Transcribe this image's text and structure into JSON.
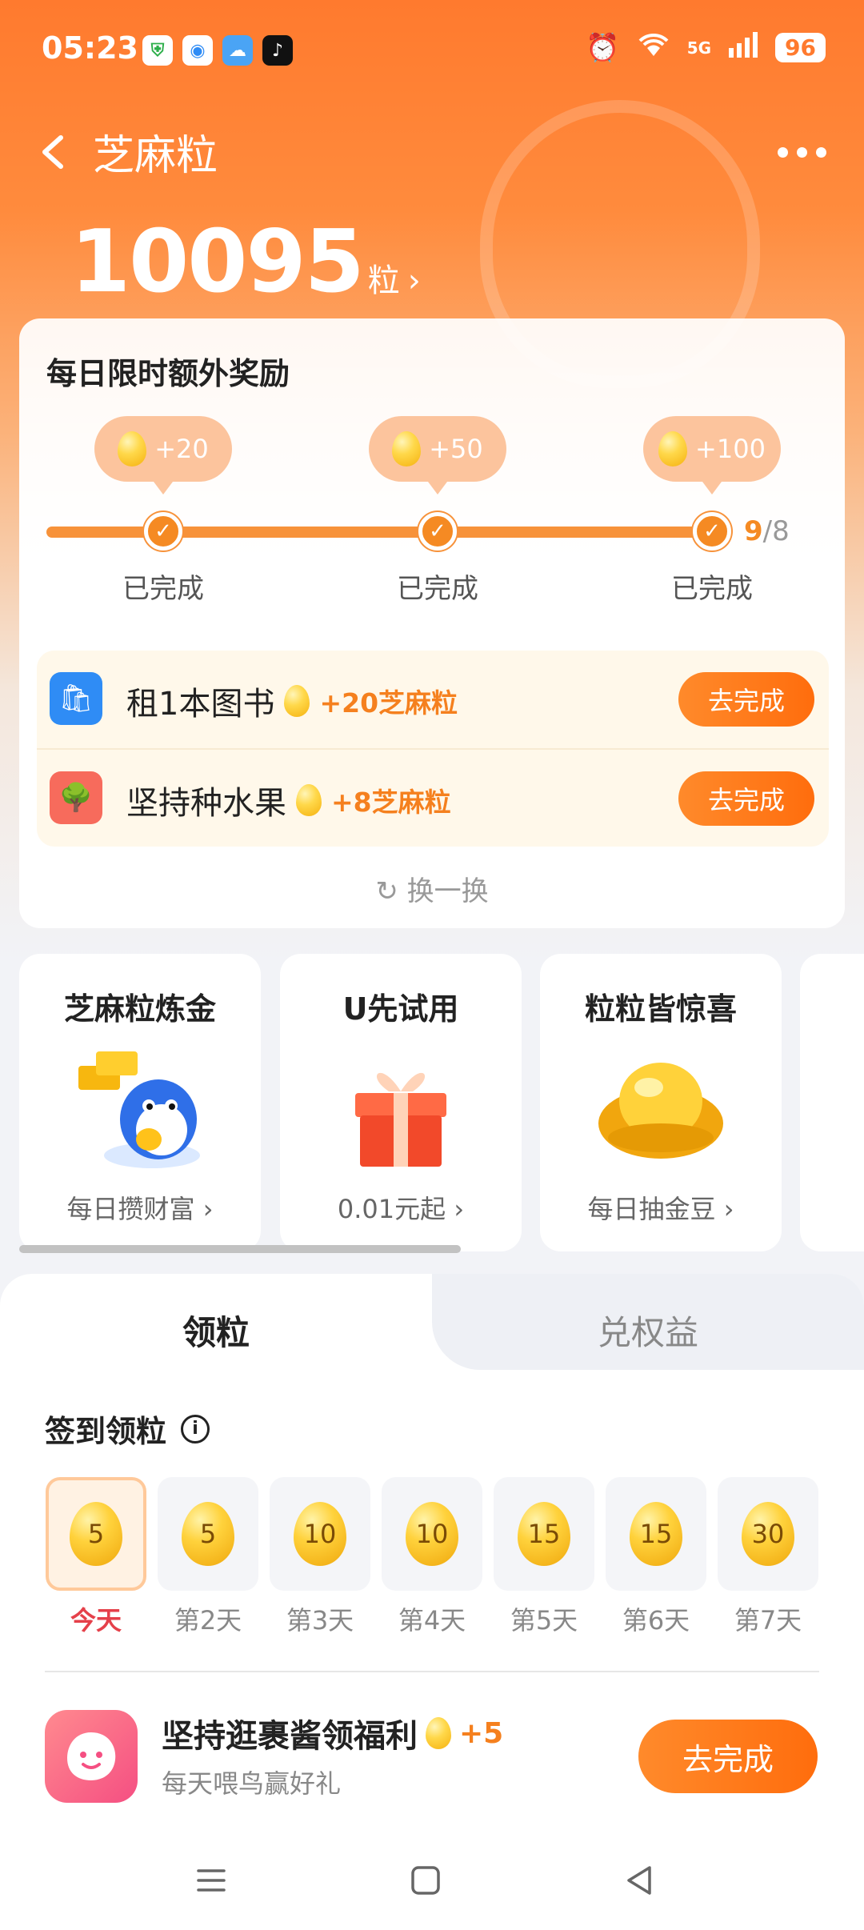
{
  "status_bar": {
    "time": "05:23",
    "network": "5G",
    "battery": "96"
  },
  "header": {
    "title": "芝麻粒"
  },
  "points": {
    "value": "10095",
    "unit": "粒"
  },
  "daily_bonus": {
    "title": "每日限时额外奖励",
    "milestones": [
      {
        "reward": "+20",
        "status": "已完成"
      },
      {
        "reward": "+50",
        "status": "已完成"
      },
      {
        "reward": "+100",
        "status": "已完成"
      }
    ],
    "progress_done": "9",
    "progress_total": "/8",
    "tasks": [
      {
        "title": "租1本图书",
        "reward": "+20芝麻粒",
        "button": "去完成",
        "icon_color": "#2f8cf5"
      },
      {
        "title": "坚持种水果",
        "reward": "+8芝麻粒",
        "button": "去完成",
        "icon_color": "#f76b5c"
      }
    ],
    "refresh": "换一换"
  },
  "promos": [
    {
      "title": "芝麻粒炼金",
      "subtitle": "每日攒财富"
    },
    {
      "title": "U先试用",
      "subtitle": "0.01元起"
    },
    {
      "title": "粒粒皆惊喜",
      "subtitle": "每日抽金豆"
    }
  ],
  "tabs": [
    {
      "label": "领粒"
    },
    {
      "label": "兑权益"
    }
  ],
  "signin": {
    "title": "签到领粒",
    "days": [
      {
        "value": "5",
        "label": "今天"
      },
      {
        "value": "5",
        "label": "第2天"
      },
      {
        "value": "10",
        "label": "第3天"
      },
      {
        "value": "10",
        "label": "第4天"
      },
      {
        "value": "15",
        "label": "第5天"
      },
      {
        "value": "15",
        "label": "第6天"
      },
      {
        "value": "30",
        "label": "第7天"
      }
    ]
  },
  "bird_task": {
    "title": "坚持逛裹酱领福利",
    "reward": "+5",
    "subtitle": "每天喂鸟赢好礼",
    "button": "去完成"
  },
  "colors": {
    "accent": "#ff7a2e",
    "reward_text": "#f5801e",
    "today_text": "#e5404a"
  }
}
